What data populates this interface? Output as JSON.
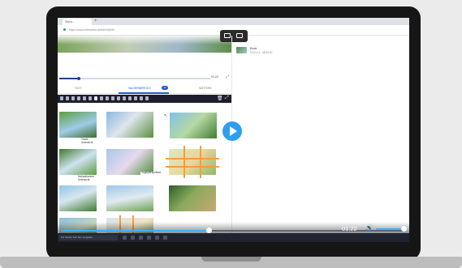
{
  "browser": {
    "tab_title": "Sichr...",
    "tab_plus": "+",
    "url": "https://www.onlineshot.de/edit/368/34"
  },
  "video_header": {
    "time": "01:22",
    "progress": 0.13
  },
  "app_tabs": [
    {
      "label": "TEXT"
    },
    {
      "label": "BILDERBEREICH",
      "badge": "12"
    },
    {
      "label": "WEITERE"
    }
  ],
  "thumbnails": [
    {
      "caption": ""
    },
    {
      "caption": ""
    },
    {
      "caption": ""
    },
    {
      "caption": "Totale\nUntersicht"
    },
    {
      "caption": ""
    },
    {
      "caption": ""
    },
    {
      "caption": "Nahaufnahme\nUntersicht"
    },
    {
      "caption": "Vogelperspektive"
    },
    {
      "caption": ""
    },
    {
      "caption": ""
    },
    {
      "caption": ""
    },
    {
      "caption": ""
    },
    {
      "caption": "Vogelperspektive"
    },
    {
      "caption": "Symmetrischer\nGoldenes"
    },
    {
      "caption": ""
    }
  ],
  "right_panel": {
    "item_title": "Ende",
    "item_date": "07.01.11 - 08:34:00"
  },
  "player": {
    "time": "01:22",
    "progress": 0.43,
    "volume": 1.0
  },
  "taskbar": {
    "search_placeholder": "Zur Suche Text hier eingeben"
  },
  "colors": {
    "accent": "#2d9ef0",
    "toolbar": "#1d1f2f",
    "handle": "#f0a040"
  }
}
